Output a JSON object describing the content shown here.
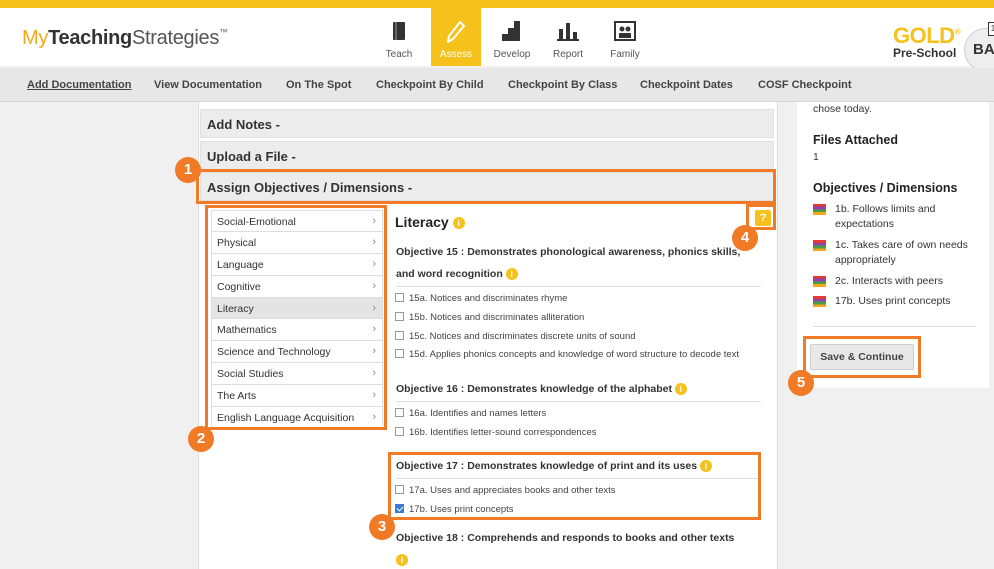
{
  "app": {
    "logo_my": "My",
    "logo_teaching": "Teaching",
    "logo_strategies": "Strategies",
    "logo_tm": "™",
    "product": "GOLD",
    "product_reg": "®",
    "level": "Pre-School",
    "avatar_initials": "BA",
    "avatar_tag": "1"
  },
  "nav": {
    "tabs": [
      {
        "label": "Teach",
        "icon": "book-icon",
        "active": false
      },
      {
        "label": "Assess",
        "icon": "pencil-icon",
        "active": true
      },
      {
        "label": "Develop",
        "icon": "stairs-icon",
        "active": false
      },
      {
        "label": "Report",
        "icon": "bar-chart-icon",
        "active": false
      },
      {
        "label": "Family",
        "icon": "family-photo-icon",
        "active": false
      }
    ]
  },
  "subnav": {
    "items": [
      "Add Documentation",
      "View Documentation",
      "On The Spot",
      "Checkpoint By Child",
      "Checkpoint By Class",
      "Checkpoint Dates",
      "COSF Checkpoint"
    ],
    "active": "Add Documentation"
  },
  "accordion": {
    "add_notes": "Add Notes  -",
    "upload_file": "Upload a File  -",
    "assign": "Assign Objectives / Dimensions  -"
  },
  "domains": [
    "Social-Emotional",
    "Physical",
    "Language",
    "Cognitive",
    "Literacy",
    "Mathematics",
    "Science and Technology",
    "Social Studies",
    "The Arts",
    "English Language Acquisition"
  ],
  "selected_domain": "Literacy",
  "literacy": {
    "title": "Literacy",
    "objectives": [
      {
        "title": "Objective 15 : Demonstrates phonological awareness, phonics skills, and word recognition",
        "items": [
          {
            "label": "15a. Notices and discriminates rhyme",
            "checked": false
          },
          {
            "label": "15b. Notices and discriminates alliteration",
            "checked": false
          },
          {
            "label": "15c. Notices and discriminates discrete units of sound",
            "checked": false
          },
          {
            "label": "15d. Applies phonics concepts and knowledge of word structure to decode text",
            "checked": false
          }
        ]
      },
      {
        "title": "Objective 16 : Demonstrates knowledge of the alphabet",
        "items": [
          {
            "label": "16a. Identifies and names letters",
            "checked": false
          },
          {
            "label": "16b. Identifies letter-sound correspondences",
            "checked": false
          }
        ]
      },
      {
        "title": "Objective 17 : Demonstrates knowledge of print and its uses",
        "items": [
          {
            "label": "17a. Uses and appreciates books and other texts",
            "checked": false
          },
          {
            "label": "17b. Uses print concepts",
            "checked": true
          }
        ]
      },
      {
        "title": "Objective 18 : Comprehends and responds to books and other texts",
        "items": []
      }
    ]
  },
  "right_panel": {
    "note_tail": "chose today.",
    "files_heading": "Files Attached",
    "files_count": "1",
    "objectives_heading": "Objectives / Dimensions",
    "selected": [
      "1b. Follows limits and expectations",
      "1c. Takes care of own needs appropriately",
      "2c. Interacts with peers",
      "17b. Uses print concepts"
    ],
    "save_button": "Save & Continue"
  },
  "annotations": [
    "1",
    "2",
    "3",
    "4",
    "5"
  ],
  "colors": {
    "brand_yellow": "#f6c11b",
    "annotation_orange": "#f07a26",
    "checkbox_blue": "#3a7bd5"
  }
}
